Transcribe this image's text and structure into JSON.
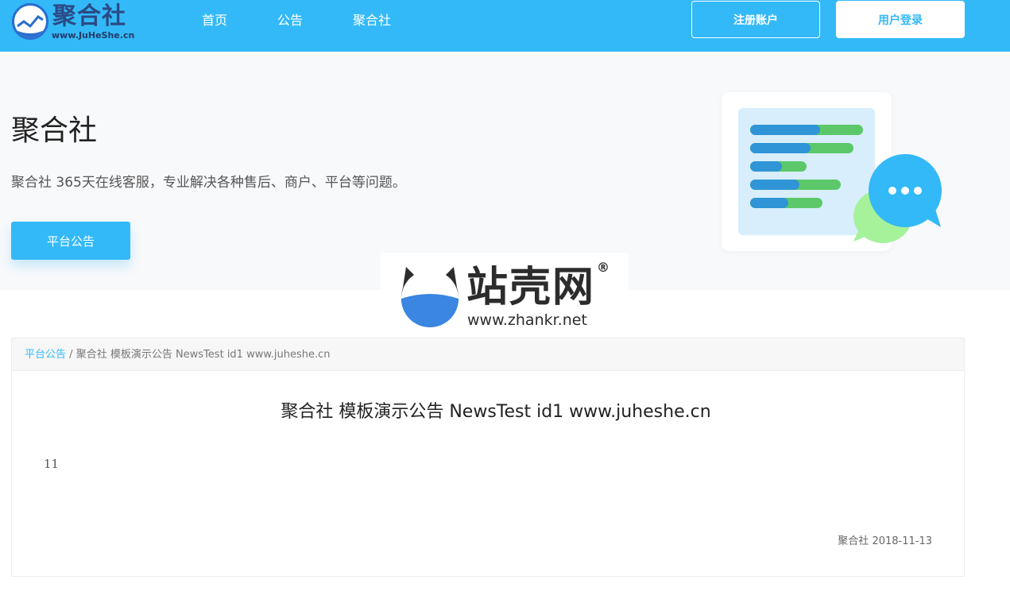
{
  "header": {
    "logo_text": "聚合社",
    "logo_url": "www.JuHeShe.cn",
    "nav": [
      {
        "label": "首页"
      },
      {
        "label": "公告"
      },
      {
        "label": "聚合社"
      }
    ],
    "register_label": "注册账户",
    "login_label": "用户登录",
    "bg_color": "#33b9f7"
  },
  "hero": {
    "title": "聚合社",
    "description": "聚合社 365天在线客服，专业解决各种售后、商户、平台等问题。",
    "button_label": "平台公告"
  },
  "watermark": {
    "name": "站壳网",
    "url": "www.zhankr.net",
    "registered": "®"
  },
  "breadcrumb": {
    "link": "平台公告",
    "separator": "/",
    "current": "聚合社 模板演示公告 NewsTest id1 www.juheshe.cn"
  },
  "article": {
    "title": "聚合社 模板演示公告 NewsTest id1 www.juheshe.cn",
    "body": "11",
    "author": "聚合社",
    "date": "2018-11-13"
  },
  "icons": [
    "site-logo-icon",
    "document-list-illustration",
    "chat-bubble-icon",
    "cat-logo-icon"
  ]
}
